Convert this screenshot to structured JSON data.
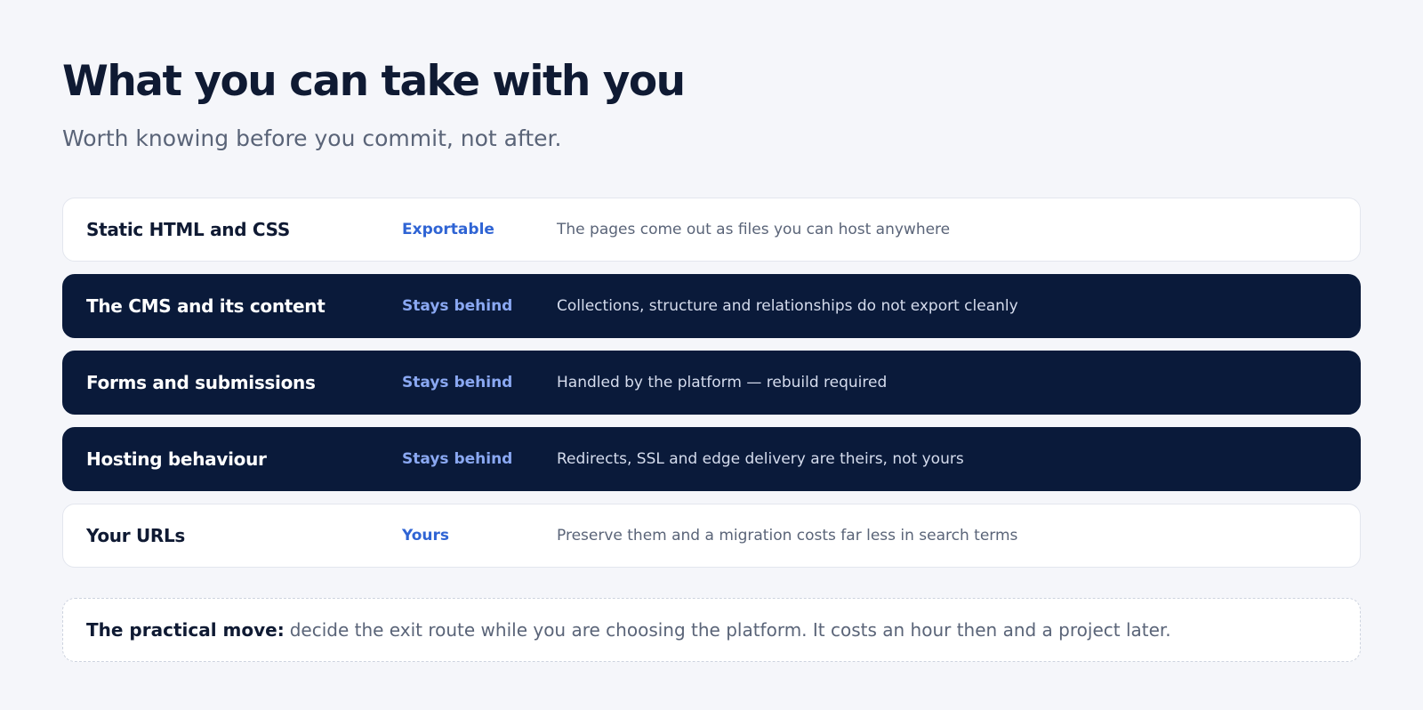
{
  "header": {
    "title": "What you can take with you",
    "subtitle": "Worth knowing before you commit, not after."
  },
  "rows": [
    {
      "name": "Static HTML and CSS",
      "status": "Exportable",
      "description": "The pages come out as files you can host anywhere",
      "theme": "light"
    },
    {
      "name": "The CMS and its content",
      "status": "Stays behind",
      "description": "Collections, structure and relationships do not export cleanly",
      "theme": "dark"
    },
    {
      "name": "Forms and submissions",
      "status": "Stays behind",
      "description": "Handled by the platform — rebuild required",
      "theme": "dark"
    },
    {
      "name": "Hosting behaviour",
      "status": "Stays behind",
      "description": "Redirects, SSL and edge delivery are theirs, not yours",
      "theme": "dark"
    },
    {
      "name": "Your URLs",
      "status": "Yours",
      "description": "Preserve them and a migration costs far less in search terms",
      "theme": "light"
    }
  ],
  "note": {
    "label": "The practical move:",
    "text": "decide the exit route while you are choosing the platform. It costs an hour then and a project later."
  },
  "colors": {
    "background": "#f5f6fa",
    "dark_row": "#0a1a3a",
    "accent_light": "#2f64d4",
    "accent_dark": "#8aa8f2"
  }
}
